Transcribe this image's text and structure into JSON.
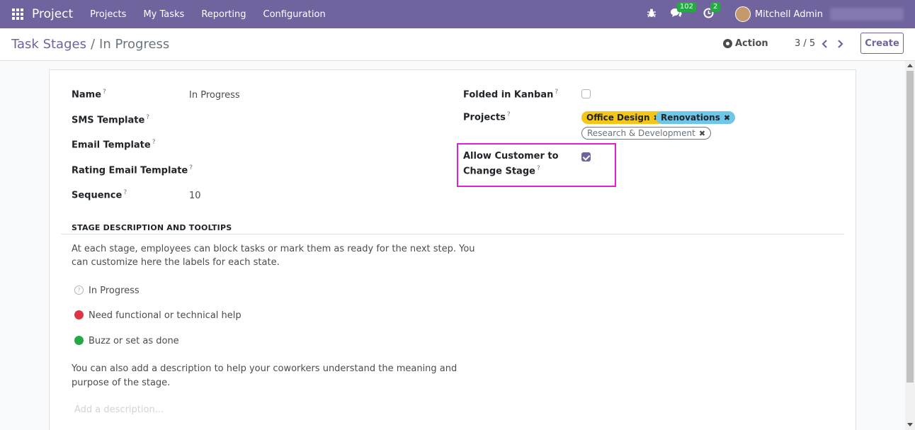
{
  "navbar": {
    "app_name": "Project",
    "menus": [
      "Projects",
      "My Tasks",
      "Reporting",
      "Configuration"
    ],
    "messages_badge": "102",
    "activities_badge": "2",
    "user_name": "Mitchell Admin"
  },
  "control_panel": {
    "breadcrumb_parent": "Task Stages",
    "breadcrumb_separator": "/",
    "breadcrumb_current": "In Progress",
    "action_label": "Action",
    "pager": "3 / 5",
    "create_label": "Create"
  },
  "form": {
    "left_fields": [
      {
        "label": "Name",
        "value": "In Progress"
      },
      {
        "label": "SMS Template",
        "value": ""
      },
      {
        "label": "Email Template",
        "value": ""
      },
      {
        "label": "Rating Email Template",
        "value": ""
      },
      {
        "label": "Sequence",
        "value": "10"
      }
    ],
    "folded_label": "Folded in Kanban",
    "folded_checked": false,
    "projects_label": "Projects",
    "project_tags": [
      "Office Design",
      "Renovations",
      "Research & Development"
    ],
    "allow_customer_label_1": "Allow Customer to",
    "allow_customer_label_2": "Change Stage",
    "allow_customer_checked": true,
    "help_mark": "?"
  },
  "description": {
    "section_title": "STAGE DESCRIPTION AND TOOLTIPS",
    "intro_line_1": "At each stage, employees can block tasks or mark them as ready for the next step. You",
    "intro_line_2": "can customize here the labels for each state.",
    "states": [
      "In Progress",
      "Need functional or technical help",
      "Buzz or set as done"
    ],
    "note_line_1": "You can also add a description to help your coworkers understand the meaning and",
    "note_line_2": "purpose of the stage.",
    "placeholder": "Add a description..."
  },
  "colors": {
    "brand": "#71639e",
    "tag_yellow": "#f5c518",
    "tag_blue": "#6ec6e9",
    "blocked": "#dc3545",
    "done": "#28a745",
    "highlight": "#e020d8"
  }
}
